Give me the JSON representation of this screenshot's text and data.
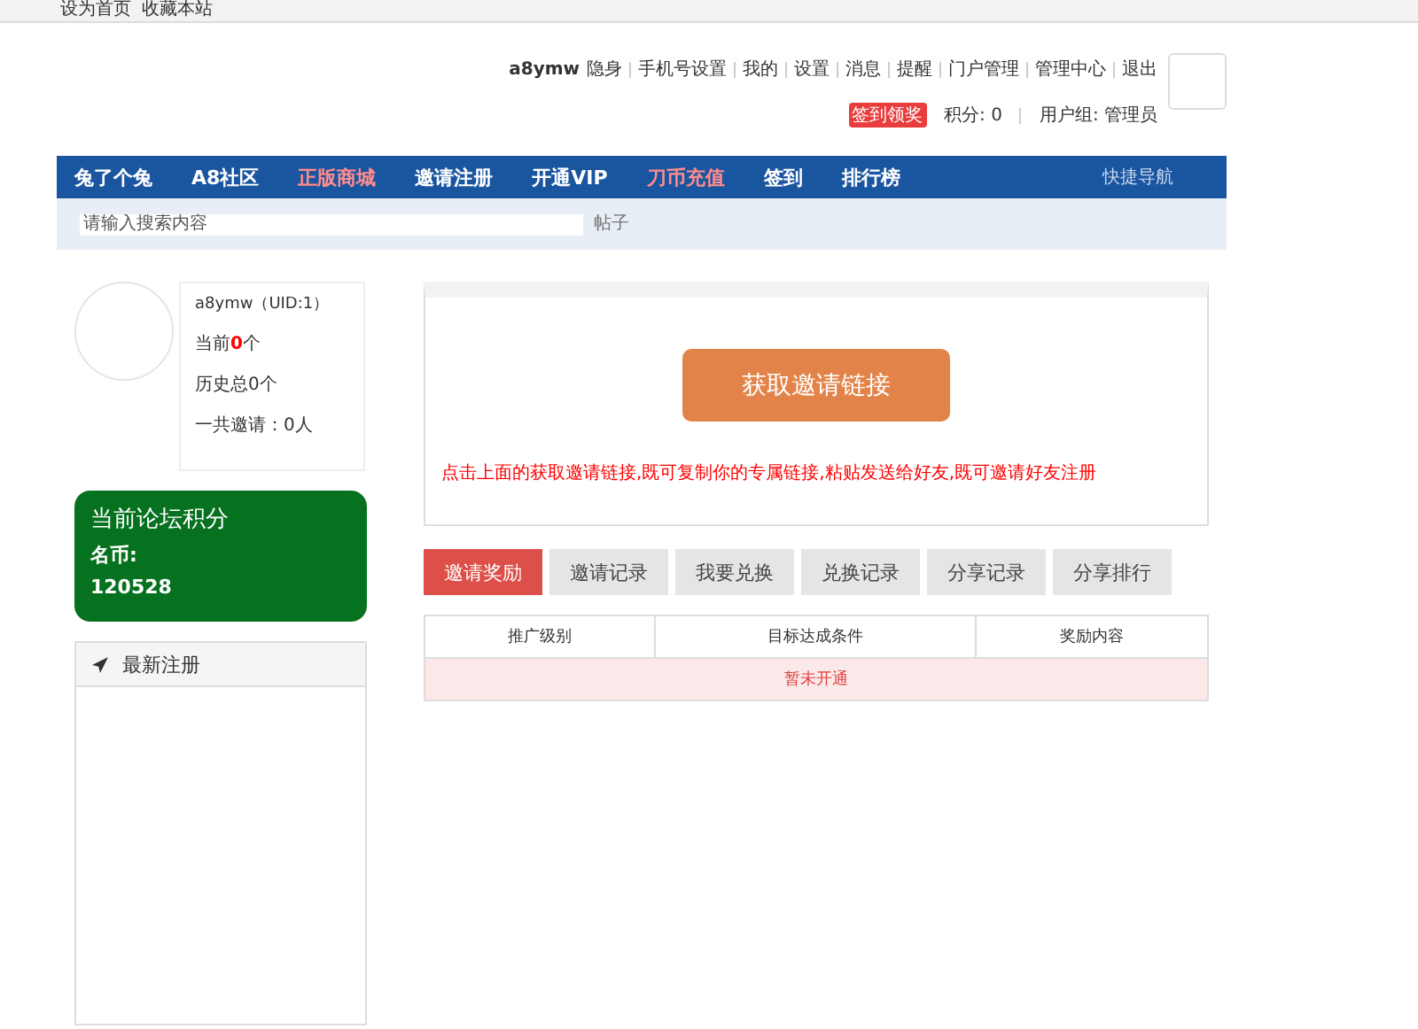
{
  "top_links": [
    "设为首页",
    "收藏本站"
  ],
  "user_bar": {
    "username": "a8ymw",
    "links": [
      {
        "label": "隐身"
      },
      {
        "label": "手机号设置"
      },
      {
        "label": "我的"
      },
      {
        "label": "设置"
      },
      {
        "label": "消息"
      },
      {
        "label": "提醒"
      },
      {
        "label": "门户管理"
      },
      {
        "label": "管理中心"
      },
      {
        "label": "退出"
      }
    ],
    "badge": "签到领奖",
    "points": "积分: 0",
    "group": "用户组: 管理员"
  },
  "nav": {
    "items": [
      {
        "label": "兔了个兔",
        "color": "#ffffff"
      },
      {
        "label": "A8社区",
        "color": "#ffffff"
      },
      {
        "label": "正版商城",
        "color": "#ff8c8c"
      },
      {
        "label": "邀请注册",
        "color": "#ffffff"
      },
      {
        "label": "开通VIP",
        "color": "#ffffff"
      },
      {
        "label": "刀币充值",
        "color": "#ff8c8c"
      },
      {
        "label": "签到",
        "color": "#ffffff"
      },
      {
        "label": "排行榜",
        "color": "#ffffff"
      }
    ],
    "quick_nav": "快捷导航"
  },
  "search": {
    "placeholder": "请输入搜索内容",
    "scope": "帖子"
  },
  "profile": {
    "name": "a8ymw（UID:1）",
    "current_prefix": "当前",
    "current_count": "0",
    "current_suffix": "个",
    "history": "历史总0个",
    "invited": "一共邀请：0人"
  },
  "score_card": {
    "title": "当前论坛积分",
    "label": "名币:",
    "value": "120528"
  },
  "latest_panel": {
    "title": "最新注册"
  },
  "invite": {
    "button": "获取邀请链接",
    "hint": "点击上面的获取邀请链接,既可复制你的专属链接,粘贴发送给好友,既可邀请好友注册"
  },
  "tabs": [
    {
      "label": "邀请奖励",
      "selected": true
    },
    {
      "label": "邀请记录",
      "selected": false
    },
    {
      "label": "我要兑换",
      "selected": false
    },
    {
      "label": "兑换记录",
      "selected": false
    },
    {
      "label": "分享记录",
      "selected": false
    },
    {
      "label": "分享排行",
      "selected": false
    }
  ],
  "table": {
    "columns": [
      "推广级别",
      "目标达成条件",
      "奖励内容"
    ],
    "empty": "暂未开通"
  }
}
